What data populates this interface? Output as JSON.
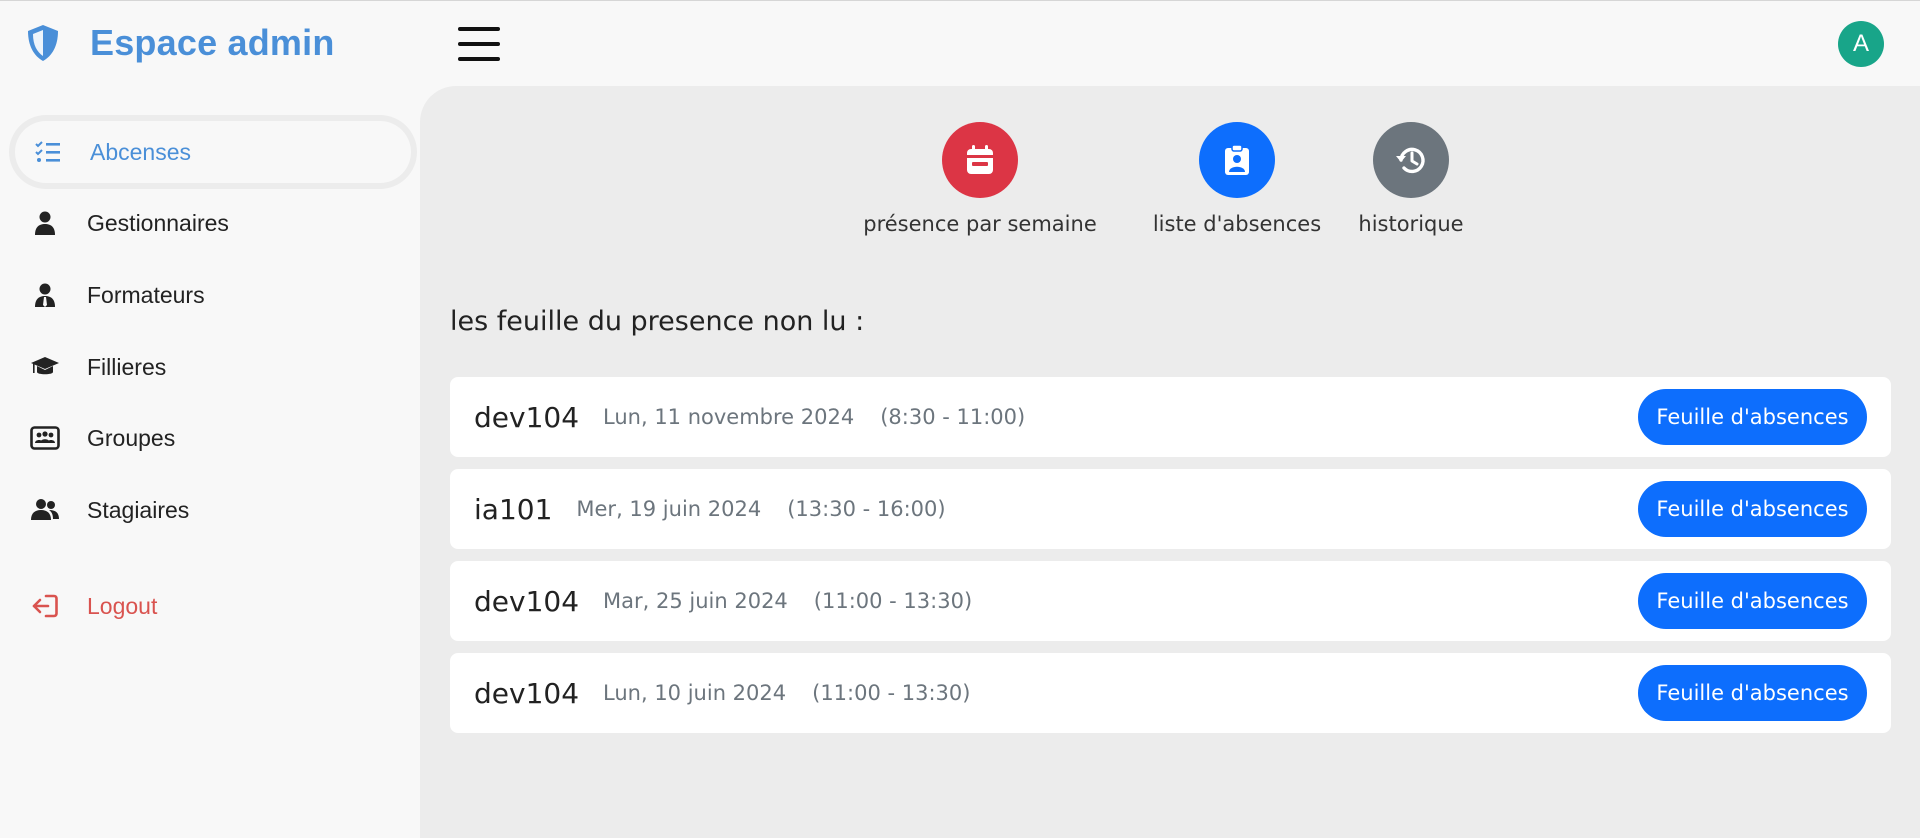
{
  "header": {
    "title": "Espace admin",
    "menu_icon": "hamburger-menu-icon",
    "avatar_letter": "A",
    "avatar_color": "#18a589",
    "brand_color": "#4a8fd8"
  },
  "sidebar": {
    "items": [
      {
        "label": "Abcenses",
        "icon": "list-check-icon",
        "active": true
      },
      {
        "label": "Gestionnaires",
        "icon": "user-icon"
      },
      {
        "label": "Formateurs",
        "icon": "user-tie-icon"
      },
      {
        "label": "Fillieres",
        "icon": "graduation-cap-icon"
      },
      {
        "label": "Groupes",
        "icon": "id-card-group-icon"
      },
      {
        "label": "Stagiaires",
        "icon": "users-icon"
      }
    ],
    "logout": {
      "label": "Logout",
      "icon": "logout-icon",
      "color": "#d9534f"
    }
  },
  "quick_actions": [
    {
      "label": "présence par semaine",
      "icon": "calendar-icon",
      "color": "#dc3545"
    },
    {
      "label": "liste d'absences",
      "icon": "clipboard-user-icon",
      "color": "#0d6efd"
    },
    {
      "label": "historique",
      "icon": "history-icon",
      "color": "#6c757d"
    }
  ],
  "main": {
    "section_title": "les feuille du presence non lu :",
    "sheets": [
      {
        "group": "dev104",
        "date": "Lun, 11 novembre 2024",
        "time": "(8:30 - 11:00)",
        "button": "Feuille d'absences"
      },
      {
        "group": "ia101",
        "date": "Mer, 19 juin 2024",
        "time": "(13:30 - 16:00)",
        "button": "Feuille d'absences"
      },
      {
        "group": "dev104",
        "date": "Mar, 25 juin 2024",
        "time": "(11:00 - 13:30)",
        "button": "Feuille d'absences"
      },
      {
        "group": "dev104",
        "date": "Lun, 10 juin 2024",
        "time": "(11:00 - 13:30)",
        "button": "Feuille d'absences"
      }
    ]
  }
}
